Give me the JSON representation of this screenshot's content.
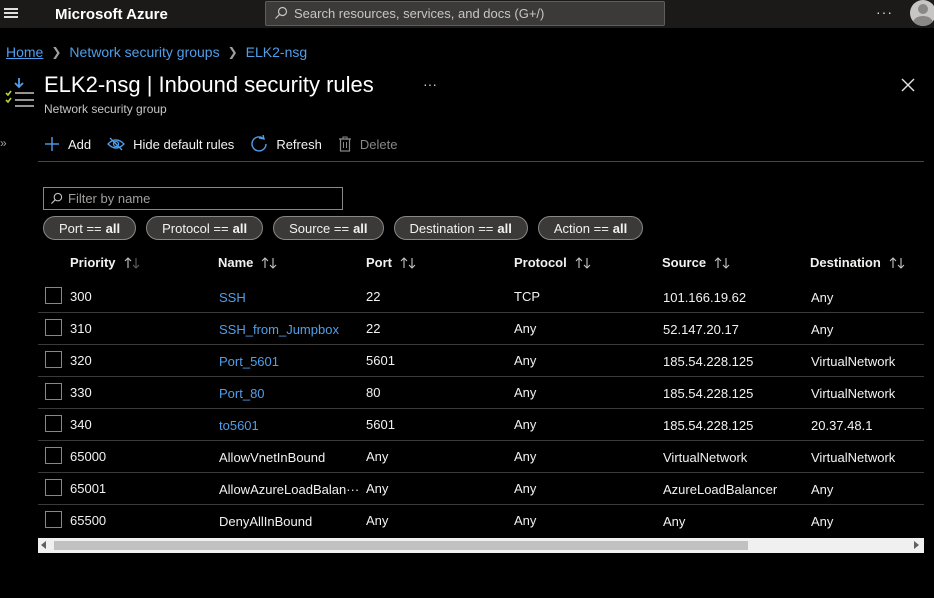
{
  "topbar": {
    "brand": "Microsoft Azure",
    "search_placeholder": "Search resources, services, and docs (G+/)",
    "more": "···"
  },
  "breadcrumb": [
    {
      "label": "Home"
    },
    {
      "label": "Network security groups"
    },
    {
      "label": "ELK2-nsg"
    }
  ],
  "page": {
    "title": "ELK2-nsg | Inbound security rules",
    "subtitle": "Network security group",
    "more": "···"
  },
  "toolbar": {
    "add": "Add",
    "hide_default": "Hide default rules",
    "refresh": "Refresh",
    "delete": "Delete"
  },
  "filter": {
    "placeholder": "Filter by name"
  },
  "pills": [
    {
      "label": "Port == ",
      "value": "all"
    },
    {
      "label": "Protocol == ",
      "value": "all"
    },
    {
      "label": "Source == ",
      "value": "all"
    },
    {
      "label": "Destination == ",
      "value": "all"
    },
    {
      "label": "Action == ",
      "value": "all"
    }
  ],
  "table": {
    "columns": [
      "Priority",
      "Name",
      "Port",
      "Protocol",
      "Source",
      "Destination"
    ],
    "rows": [
      {
        "priority": "300",
        "name": "SSH",
        "port": "22",
        "protocol": "TCP",
        "source": "101.166.19.62",
        "destination": "Any",
        "link": true
      },
      {
        "priority": "310",
        "name": "SSH_from_Jumpbox",
        "port": "22",
        "protocol": "Any",
        "source": "52.147.20.17",
        "destination": "Any",
        "link": true
      },
      {
        "priority": "320",
        "name": "Port_5601",
        "port": "5601",
        "protocol": "Any",
        "source": "185.54.228.125",
        "destination": "VirtualNetwork",
        "link": true
      },
      {
        "priority": "330",
        "name": "Port_80",
        "port": "80",
        "protocol": "Any",
        "source": "185.54.228.125",
        "destination": "VirtualNetwork",
        "link": true
      },
      {
        "priority": "340",
        "name": "to5601",
        "port": "5601",
        "protocol": "Any",
        "source": "185.54.228.125",
        "destination": "20.37.48.1",
        "link": true
      },
      {
        "priority": "65000",
        "name": "AllowVnetInBound",
        "port": "Any",
        "protocol": "Any",
        "source": "VirtualNetwork",
        "destination": "VirtualNetwork",
        "link": false
      },
      {
        "priority": "65001",
        "name": "AllowAzureLoadBalan···",
        "port": "Any",
        "protocol": "Any",
        "source": "AzureLoadBalancer",
        "destination": "Any",
        "link": false
      },
      {
        "priority": "65500",
        "name": "DenyAllInBound",
        "port": "Any",
        "protocol": "Any",
        "source": "Any",
        "destination": "Any",
        "link": false
      }
    ]
  },
  "colors": {
    "link": "#4f9fea",
    "accent": "#0078d4",
    "background": "#000000",
    "topbar": "#1b1a19"
  }
}
